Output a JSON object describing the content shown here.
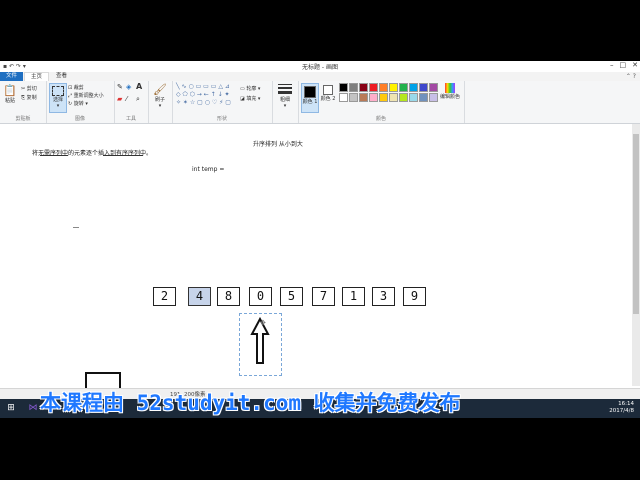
{
  "window": {
    "title": "无标题 - 画图",
    "min": "–",
    "max": "□",
    "close": "✕"
  },
  "tabs": {
    "file": "文件",
    "home": "主页",
    "view": "查看"
  },
  "ribbon": {
    "clipboard": {
      "paste": "粘贴",
      "cut": "剪切",
      "copy": "复制",
      "label": "剪贴板"
    },
    "image": {
      "select": "选择",
      "crop": "裁剪",
      "resize": "重新调整大小",
      "rotate": "旋转",
      "label": "图像"
    },
    "tools": {
      "label": "工具",
      "text_tool": "A"
    },
    "brushes": {
      "label": "刷子"
    },
    "shapes": {
      "label": "形状",
      "outline": "轮廓",
      "fill": "填充"
    },
    "size": {
      "label": "粗细"
    },
    "colors": {
      "color1": "颜色 1",
      "color2": "颜色 2",
      "edit": "编辑颜色",
      "label": "颜色",
      "palette": [
        "#000000",
        "#7f7f7f",
        "#880015",
        "#ed1c24",
        "#ff7f27",
        "#fff200",
        "#22b14c",
        "#00a2e8",
        "#3f48cc",
        "#a349a4",
        "#ffffff",
        "#c3c3c3",
        "#b97a57",
        "#ffaec9",
        "#ffc90e",
        "#efe4b0",
        "#b5e61d",
        "#99d9ea",
        "#7092be",
        "#c8bfe7"
      ]
    }
  },
  "canvas": {
    "heading": "升序排列 从小到大",
    "instruction": "将无需序列中的元素逐个插入到有序序列中。",
    "code": "int temp =",
    "numbers": [
      "2",
      "4",
      "8",
      "0",
      "5",
      "7",
      "1",
      "3",
      "9"
    ]
  },
  "statusbar": {
    "text": "191, 200像素"
  },
  "taskbar": {
    "time": "16:14",
    "date": "2017/4/8"
  },
  "watermark": "本课程由 52studyit.com 收集并免费发布"
}
